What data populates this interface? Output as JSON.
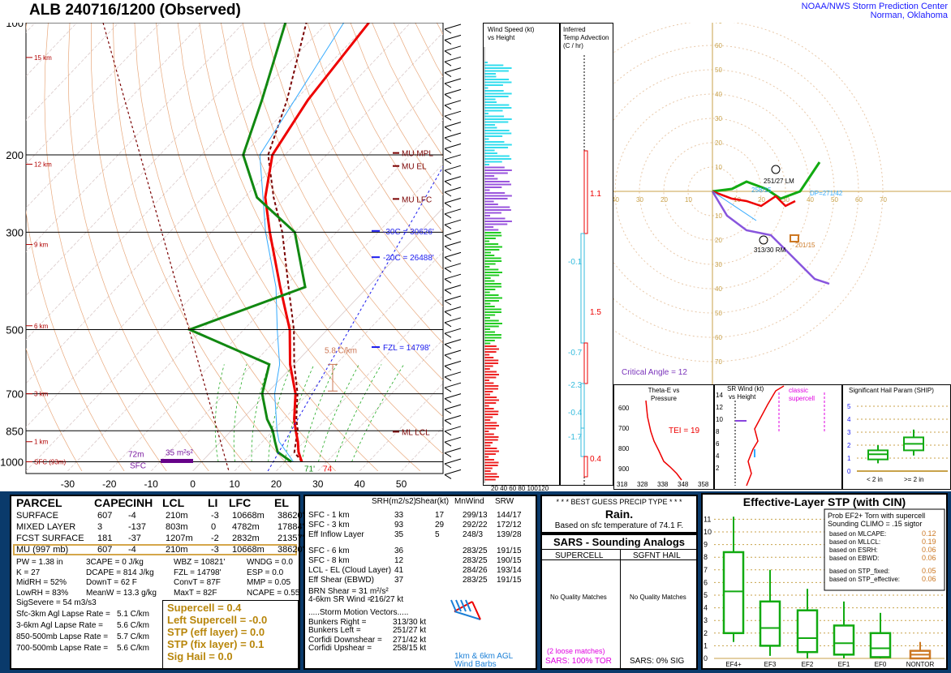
{
  "header": {
    "title": "ALB  240716/1200  (Observed)",
    "org_line1": "NOAA/NWS Storm Prediction Center",
    "org_line2": "Norman, Oklahoma"
  },
  "skewt": {
    "pressure_labels": [
      "100",
      "200",
      "300",
      "500",
      "700",
      "850",
      "1000"
    ],
    "temp_labels": [
      "-30",
      "-20",
      "-10",
      "0",
      "10",
      "20",
      "30",
      "40",
      "50"
    ],
    "height_labels": [
      "15 km",
      "12 km",
      "9 km",
      "6 km",
      "3 km",
      "1 km",
      "SFC (93m)"
    ],
    "annotations": {
      "mu_mpl": "MU MPL",
      "mu_el": "MU EL",
      "mu_lfc": "MU LFC",
      "ml_lcl": "ML LCL",
      "m30c": "-30C = 30626'",
      "m20c": "-20C = 26488'",
      "fzl": "FZL = 14798'",
      "lapse": "5.8 C/km",
      "sfc_t": "74",
      "sfc_td": "71'",
      "eff_h": "72m",
      "eff_sfc": "SFC",
      "srh": "35 m²s²"
    }
  },
  "wind_panel": {
    "title1": "Wind Speed (kt)",
    "title2": "vs Height",
    "axis": "20 40 60 80 100120"
  },
  "temp_adv": {
    "title1": "Inferred",
    "title2": "Temp Advection",
    "title3": "(C / hr)",
    "values": [
      "1.1",
      "-0.1",
      "1.5",
      "-0.7",
      "-2.3",
      "-0.4",
      "-1.7",
      "0.4"
    ]
  },
  "hodo": {
    "rings": [
      "10",
      "20",
      "30",
      "40",
      "50",
      "60",
      "70"
    ],
    "lm": "251/27 LM",
    "rm": "313/30 RM",
    "dp": "DP=271/42",
    "mean": "258/15",
    "dir": "201/15",
    "critical_angle": "Critical Angle = 12"
  },
  "thetae": {
    "title1": "Theta-E vs",
    "title2": "Pressure",
    "tei": "TEI = 19",
    "y": [
      "600",
      "700",
      "800",
      "900"
    ],
    "x": [
      "318",
      "328",
      "338",
      "348",
      "358"
    ]
  },
  "srwind": {
    "title1": "SR Wind (kt)",
    "title2": "vs Height",
    "classic": "classic",
    "supercell": "supercell",
    "y": [
      "14",
      "12",
      "10",
      "8",
      "6",
      "4",
      "2"
    ]
  },
  "ship": {
    "title": "Significant Hail Param (SHIP)",
    "y": [
      "5",
      "4",
      "3",
      "2",
      "1",
      "0"
    ],
    "x1": "< 2 in",
    "x2": ">= 2 in"
  },
  "parcel": {
    "headers": [
      "PARCEL",
      "CAPE",
      "CINH",
      "LCL",
      "LI",
      "LFC",
      "EL"
    ],
    "rows": [
      [
        "SURFACE",
        "607",
        "-4",
        "210m",
        "-3",
        "10668m",
        "38620'"
      ],
      [
        "MIXED LAYER",
        "3",
        "-137",
        "803m",
        "0",
        "4782m",
        "17884'"
      ],
      [
        "FCST SURFACE",
        "181",
        "-37",
        "1207m",
        "-2",
        "2832m",
        "21357'"
      ],
      [
        "MU  (997 mb)",
        "607",
        "-4",
        "210m",
        "-3",
        "10668m",
        "38620'"
      ]
    ],
    "params_col1": [
      "PW = 1.38 in",
      "K = 27",
      "MidRH = 52%",
      "LowRH = 83%",
      "SigSevere = 54 m3/s3"
    ],
    "params_col2": [
      "3CAPE = 0 J/kg",
      "DCAPE = 814 J/kg",
      "DownT = 62 F",
      "MeanW = 13.3 g/kg"
    ],
    "params_col3": [
      "WBZ = 10821'",
      "FZL = 14798'",
      "ConvT = 87F",
      "MaxT = 82F"
    ],
    "params_col4": [
      "WNDG = 0.0",
      "ESP = 0.0",
      "MMP = 0.05",
      "NCAPE = 0.55"
    ],
    "lapse": [
      [
        "Sfc-3km Agl Lapse Rate =",
        "5.1 C/km"
      ],
      [
        "3-6km Agl Lapse Rate =",
        "5.6 C/km"
      ],
      [
        "850-500mb Lapse Rate =",
        "5.7 C/km"
      ],
      [
        "700-500mb Lapse Rate =",
        "5.6 C/km"
      ]
    ],
    "composite": [
      "Supercell = 0.4",
      "Left Supercell = -0.0",
      "STP (eff layer) = 0.0",
      "STP (fix layer) = 0.1",
      "Sig Hail = 0.0"
    ]
  },
  "kinematics": {
    "headers": [
      "SRH(m2/s2)",
      "Shear(kt)",
      "MnWind",
      "SRW"
    ],
    "rows": [
      [
        "SFC - 1 km",
        "33",
        "17",
        "299/13",
        "144/17"
      ],
      [
        "SFC - 3 km",
        "93",
        "29",
        "292/22",
        "172/12"
      ],
      [
        "Eff Inflow Layer",
        "35",
        "5",
        "248/3",
        "139/28"
      ],
      [
        "SFC - 6 km",
        "36",
        "283/25",
        "191/15"
      ],
      [
        "SFC - 8 km",
        "12",
        "283/25",
        "190/15"
      ],
      [
        "LCL - EL (Cloud Layer)",
        "41",
        "284/26",
        "193/14"
      ],
      [
        "Eff Shear (EBWD)",
        "37",
        "283/25",
        "191/15"
      ]
    ],
    "brn": "BRN Shear = 31 m²/s²",
    "sr46": "4-6km SR Wind =",
    "sr46v": "216/27 kt",
    "storm_title": ".....Storm Motion Vectors.....",
    "storm": [
      [
        "Bunkers Right =",
        "313/30 kt"
      ],
      [
        "Bunkers Left =",
        "251/27 kt"
      ],
      [
        "Corfidi Downshear =",
        "271/42 kt"
      ],
      [
        "Corfidi Upshear =",
        "258/15 kt"
      ]
    ],
    "barb_note1": "1km & 6km AGL",
    "barb_note2": "Wind Barbs"
  },
  "precip": {
    "title": "* * * BEST GUESS PRECIP TYPE * * *",
    "value": "Rain.",
    "basis": "Based on sfc temperature of 74.1 F."
  },
  "analogs": {
    "title": "SARS - Sounding Analogs",
    "col1": "SUPERCELL",
    "col2": "SGFNT HAIL",
    "nomatch1": "No Quality Matches",
    "nomatch2": "No Quality Matches",
    "loose": "(2 loose matches)",
    "tor": "SARS:  100% TOR",
    "sig": "SARS:  0% SIG"
  },
  "stp": {
    "title": "Effective-Layer STP (with CIN)",
    "prob_title1": "Prob EF2+ Torn with supercell",
    "prob_title2": "Sounding CLIMO = .15 sigtor",
    "probs": [
      [
        "based on MLCAPE:",
        "0.12"
      ],
      [
        "based on MLLCL:",
        "0.19"
      ],
      [
        "based on ESRH:",
        "0.06"
      ],
      [
        "based on EBWD:",
        "0.06"
      ],
      [
        "based on STP_fixed:",
        "0.05"
      ],
      [
        "based on STP_effective:",
        "0.06"
      ]
    ],
    "y": [
      "11",
      "10",
      "9",
      "8",
      "7",
      "6",
      "5",
      "4",
      "3",
      "2",
      "1",
      "0"
    ],
    "cats": [
      "EF4+",
      "EF3",
      "EF2",
      "EF1",
      "EF0",
      "NONTOR"
    ]
  },
  "chart_data": [
    {
      "type": "line",
      "title": "",
      "xlabel": "",
      "ylabel": "",
      "series": [
        {
          "name": "Temperature",
          "points": [
            [
              1000,
              24
            ],
            [
              950,
              21
            ],
            [
              900,
              18.5
            ],
            [
              850,
              15.5
            ],
            [
              800,
              12.5
            ],
            [
              700,
              7
            ],
            [
              600,
              -1
            ],
            [
              500,
              -9
            ],
            [
              400,
              -21
            ],
            [
              300,
              -36
            ],
            [
              250,
              -45
            ],
            [
              200,
              -53
            ],
            [
              150,
              -57
            ],
            [
              100,
              -60
            ]
          ]
        },
        {
          "name": "Dewpoint",
          "points": [
            [
              1000,
              21.5
            ],
            [
              950,
              16
            ],
            [
              900,
              13
            ],
            [
              850,
              10
            ],
            [
              800,
              6
            ],
            [
              700,
              -1
            ],
            [
              600,
              -6
            ],
            [
              500,
              -33
            ],
            [
              400,
              -15
            ],
            [
              300,
              -30
            ],
            [
              250,
              -47
            ],
            [
              200,
              -60
            ],
            [
              150,
              -68
            ],
            [
              100,
              -80
            ]
          ]
        }
      ]
    },
    {
      "type": "bar",
      "title": "Significant Hail Param (SHIP)",
      "categories": [
        "< 2 in",
        ">= 2 in"
      ],
      "values": [
        1.3,
        2.1
      ]
    },
    {
      "type": "bar",
      "title": "Effective-Layer STP (with CIN)",
      "categories": [
        "EF4+",
        "EF3",
        "EF2",
        "EF1",
        "EF0",
        "NONTOR"
      ],
      "series": [
        {
          "values": [
            5.3,
            2.4,
            1.6,
            1.2,
            0.8,
            0.3
          ]
        }
      ]
    }
  ]
}
